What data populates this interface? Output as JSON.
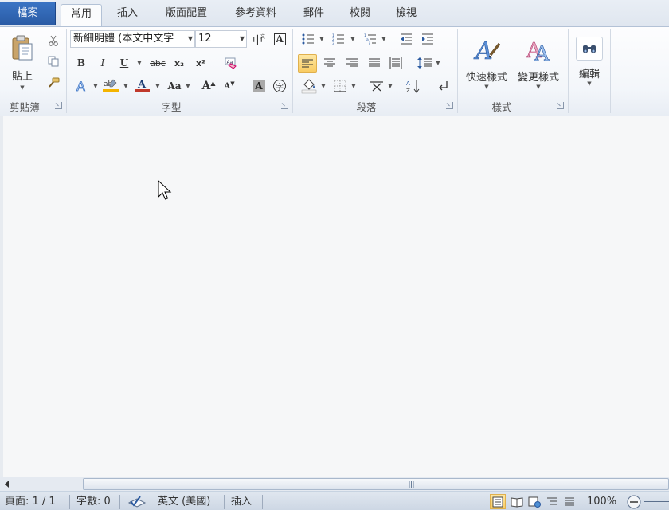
{
  "tabs": {
    "file": "檔案",
    "home": "常用",
    "insert": "插入",
    "page_layout": "版面配置",
    "references": "參考資料",
    "mailings": "郵件",
    "review": "校閱",
    "view": "檢視"
  },
  "clipboard": {
    "paste_label": "貼上",
    "group_label": "剪貼簿"
  },
  "font": {
    "font_name": "新細明體 (本文中文字",
    "font_size": "12",
    "group_label": "字型",
    "bold": "B",
    "italic": "I",
    "underline": "U",
    "strikethrough": "abc",
    "subscript": "x₂",
    "superscript": "x²",
    "change_case": "Aa",
    "grow": "A",
    "shrink": "A",
    "char_shading": "A",
    "enclose": "字",
    "phonetic": "中",
    "char_border": "A"
  },
  "paragraph": {
    "group_label": "段落"
  },
  "styles": {
    "quick_styles": "快速樣式",
    "change_styles": "變更樣式",
    "group_label": "樣式"
  },
  "editing": {
    "label": "編輯"
  },
  "statusbar": {
    "page": "頁面: 1 / 1",
    "words": "字數: 0",
    "language": "英文 (美國)",
    "mode": "插入",
    "zoom": "100%"
  },
  "colors": {
    "accent_file_tab": "#2a5ba5",
    "highlight": "#f4b400",
    "font_color": "#c0392b"
  }
}
